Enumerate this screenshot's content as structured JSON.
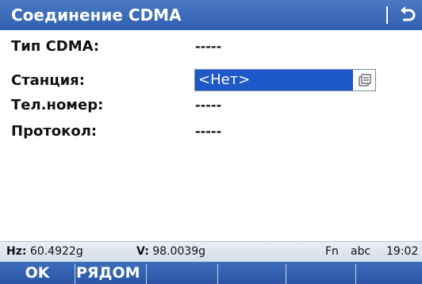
{
  "header": {
    "title": "Соединение CDMA",
    "back_icon": "back-arrow-icon"
  },
  "fields": {
    "cdma_type": {
      "label": "Тип CDMA:",
      "value": "-----"
    },
    "station": {
      "label": "Станция:",
      "value": "<Нет>",
      "icon": "dropdown-list-icon"
    },
    "phone": {
      "label": "Тел.номер:",
      "value": "-----"
    },
    "protocol": {
      "label": "Протокол:",
      "value": "-----"
    }
  },
  "status": {
    "hz_label": "Hz:",
    "hz_value": "60.4922g",
    "v_label": "V:",
    "v_value": "98.0039g",
    "fn": "Fn",
    "mode": "abc",
    "time": "19:02"
  },
  "softkeys": {
    "f1": "OK",
    "f2": "РЯДОМ",
    "f3": "",
    "f4": "",
    "f5": "",
    "f6": ""
  },
  "colors": {
    "titlebar": "#2f5fb0",
    "selection": "#1d59c9",
    "softkey_bar": "#2a56a3"
  }
}
